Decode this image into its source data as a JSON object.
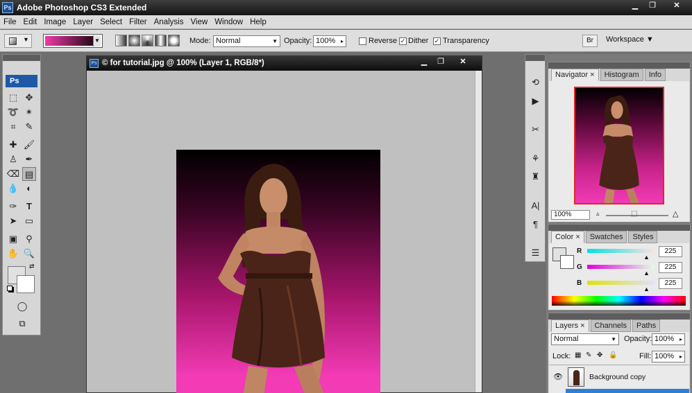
{
  "app": {
    "title": "Adobe Photoshop CS3 Extended",
    "logo": "Ps"
  },
  "menu": [
    "File",
    "Edit",
    "Image",
    "Layer",
    "Select",
    "Filter",
    "Analysis",
    "View",
    "Window",
    "Help"
  ],
  "options": {
    "mode_label": "Mode:",
    "mode_value": "Normal",
    "opacity_label": "Opacity:",
    "opacity_value": "100%",
    "reverse_label": "Reverse",
    "dither_label": "Dither",
    "transparency_label": "Transparency",
    "workspace_label": "Workspace",
    "gradient_colors": [
      "#ee3ba8",
      "#2a0818"
    ]
  },
  "toolbox": {
    "logo": "Ps"
  },
  "document": {
    "title": "© for tutorial.jpg @ 100% (Layer 1, RGB/8*)"
  },
  "navigator": {
    "tabs": [
      "Navigator",
      "Histogram",
      "Info"
    ],
    "zoom": "100%"
  },
  "color_panel": {
    "tabs": [
      "Color",
      "Swatches",
      "Styles"
    ],
    "channels": [
      {
        "name": "R",
        "value": "225"
      },
      {
        "name": "G",
        "value": "225"
      },
      {
        "name": "B",
        "value": "225"
      }
    ]
  },
  "layers": {
    "tabs": [
      "Layers",
      "Channels",
      "Paths"
    ],
    "blend_mode": "Normal",
    "opacity_label": "Opacity:",
    "opacity_value": "100%",
    "lock_label": "Lock:",
    "fill_label": "Fill:",
    "fill_value": "100%",
    "items": [
      {
        "name": "Background copy"
      }
    ]
  },
  "colors": {
    "accent": "#1c4f8e",
    "canvas_bg": "#c0c0c0",
    "pink": "#f23bb5"
  }
}
